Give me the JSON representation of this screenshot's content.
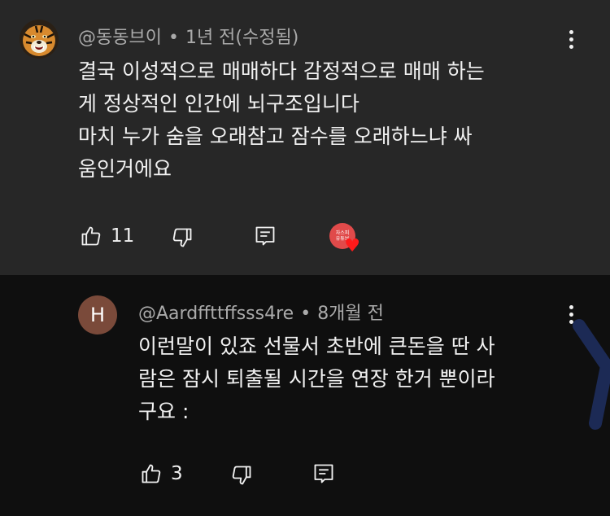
{
  "comment": {
    "author": "@동동브이",
    "separator": "•",
    "time": "1년 전(수정됨)",
    "text_lines": [
      "결국 이성적으로 매매하다 감정적으로 매매 하는",
      "게 정상적인 인간에 뇌구조입니다",
      "마치 누가 숨을 오래참고 잠수를 오래하느냐 싸",
      "움인거에요"
    ],
    "like_count": "11",
    "avatar_icon": "tiger-avatar",
    "creator_heart_avatar_lines": [
      "자스피",
      "유튜브"
    ],
    "heart_icon": "red-heart",
    "colors": {
      "card_bg": "#272727",
      "heart": "#ff1a1a"
    }
  },
  "reply": {
    "avatar_letter": "H",
    "author": "@Aardffttffsss4re",
    "separator": "•",
    "time": "8개월 전",
    "text_lines": [
      "이런말이 있죠 선물서 초반에 큰돈을 딴 사",
      "람은 잠시 퇴출될 시간을 연장 한거 뿐이라",
      "구요 :"
    ],
    "like_count": "3",
    "colors": {
      "avatar_bg": "#7a4a3a",
      "bg": "#0f0f0f"
    }
  }
}
